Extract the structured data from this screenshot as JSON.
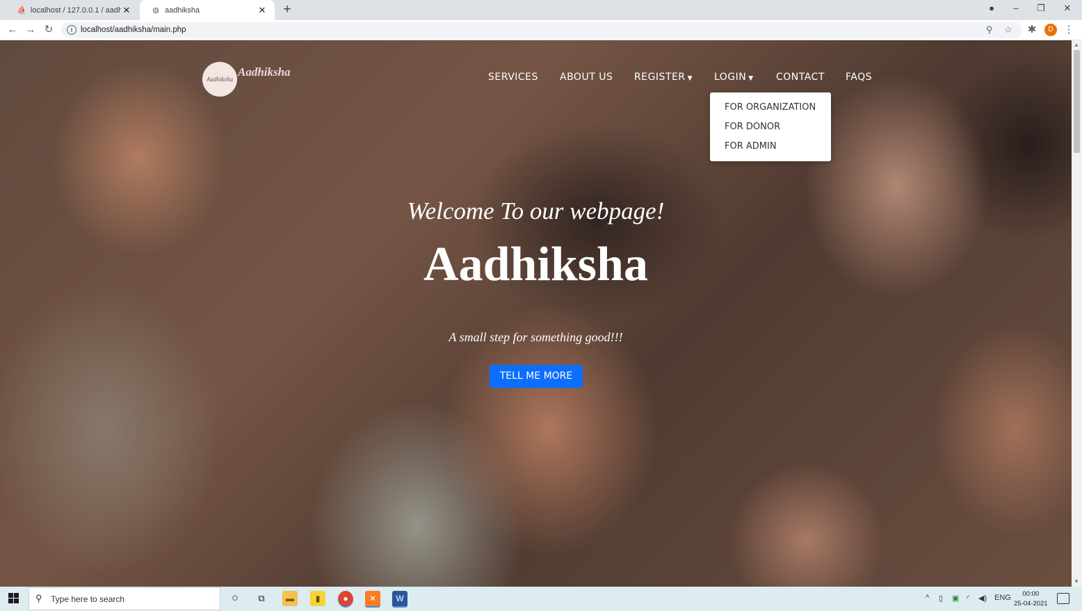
{
  "browser": {
    "tabs": [
      {
        "title": "localhost / 127.0.0.1 / aadhiksha",
        "icon": "phpmyadmin-icon"
      },
      {
        "title": "aadhiksha",
        "icon": "globe-icon"
      }
    ],
    "url": "localhost/aadhiksha/main.php",
    "profile_initial": "D"
  },
  "site": {
    "brand": "Aadhiksha",
    "logo_text": "Aadhiksha",
    "nav": {
      "services": "SERVICES",
      "about": "ABOUT US",
      "register": "REGISTER",
      "login": "LOGIN",
      "contact": "CONTACT",
      "faqs": "FAQS"
    },
    "login_dropdown": [
      "FOR ORGANIZATION",
      "FOR DONOR",
      "FOR ADMIN"
    ],
    "hero": {
      "welcome": "Welcome To our webpage!",
      "title": "Aadhiksha",
      "tagline": "A small step for something good!!!",
      "cta": "TELL ME MORE"
    },
    "colors": {
      "cta": "#0d6efd"
    }
  },
  "taskbar": {
    "search_placeholder": "Type here to search",
    "language": "ENG",
    "time": "00:00",
    "date": "25-04-2021",
    "apps": [
      "cortana-icon",
      "task-view-icon",
      "file-explorer-icon",
      "sticky-notes-icon",
      "chrome-icon",
      "xampp-icon",
      "word-icon"
    ]
  }
}
